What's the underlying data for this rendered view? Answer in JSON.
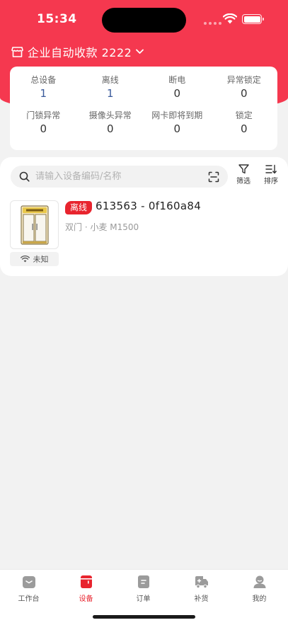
{
  "status_bar": {
    "time": "15:34"
  },
  "header": {
    "store_name": "企业自动收款 2222"
  },
  "stats": [
    {
      "label": "总设备",
      "value": "1",
      "accent": true
    },
    {
      "label": "离线",
      "value": "1",
      "accent": true
    },
    {
      "label": "断电",
      "value": "0",
      "accent": false
    },
    {
      "label": "异常锁定",
      "value": "0",
      "accent": false
    },
    {
      "label": "门锁异常",
      "value": "0",
      "accent": false
    },
    {
      "label": "摄像头异常",
      "value": "0",
      "accent": false
    },
    {
      "label": "网卡即将到期",
      "value": "0",
      "accent": false
    },
    {
      "label": "锁定",
      "value": "0",
      "accent": false
    }
  ],
  "search": {
    "placeholder": "请输入设备编码/名称",
    "value": ""
  },
  "toolbar": {
    "filter_label": "筛选",
    "sort_label": "排序"
  },
  "devices": [
    {
      "status": "离线",
      "title": "613563 - 0f160a84",
      "subtitle": "双门 · 小麦 M1500",
      "network": "未知",
      "icon": "double-door-fridge-icon"
    }
  ],
  "tabbar": [
    {
      "label": "工作台",
      "icon": "workbench-icon",
      "active": false
    },
    {
      "label": "设备",
      "icon": "device-icon",
      "active": true
    },
    {
      "label": "订单",
      "icon": "order-icon",
      "active": false
    },
    {
      "label": "补货",
      "icon": "restock-truck-icon",
      "active": false
    },
    {
      "label": "我的",
      "icon": "profile-icon",
      "active": false
    }
  ],
  "colors": {
    "brand": "#f5384f",
    "accent_text": "#3a5a9b",
    "offline_tag": "#e8242e"
  }
}
